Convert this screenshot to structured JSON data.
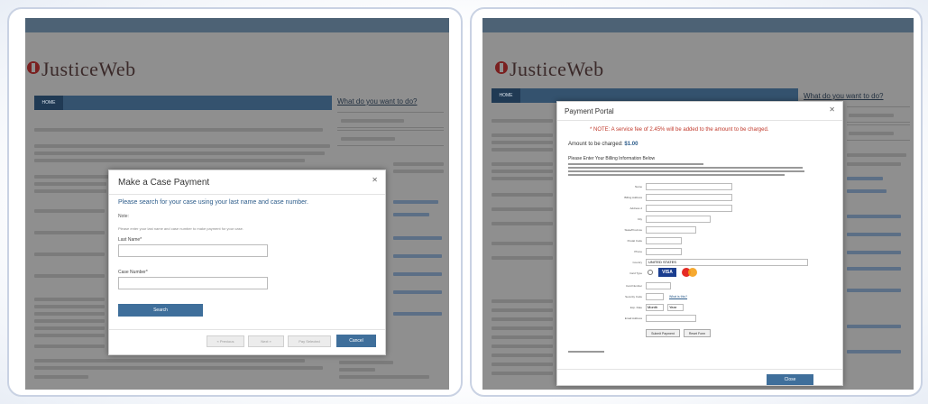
{
  "left": {
    "app_title": "JusticeWeb",
    "tab_home": "HOME",
    "sidebar_heading": "What do you want to do?",
    "modal": {
      "title": "Make a Case Payment",
      "subtitle": "Please search for your case using your last name and case number.",
      "note": "Note:",
      "help": "Please enter your last name and case number to make payment for your case.",
      "last_name_label": "Last Name*",
      "last_name_value": "",
      "case_number_label": "Case Number*",
      "case_number_value": "",
      "search_button": "Search",
      "previous_button": "« Previous",
      "next_button": "Next »",
      "pay_button": "Pay Selected",
      "cancel_button": "Cancel"
    }
  },
  "right": {
    "app_title": "JusticeWeb",
    "tab_home": "HOME",
    "sidebar_heading": "What do you want to do?",
    "modal": {
      "title": "Payment Portal",
      "notice": "* NOTE: A service fee of 2.45% will be added to the amount to be charged.",
      "amount_label": "Amount to be charged:",
      "amount_value": "$1.00",
      "enter_info": "Please Enter Your Billing Information Below",
      "fields": [
        "Name",
        "Billing Address",
        "Address 2",
        "City",
        "State/Province",
        "Postal Code",
        "Phone",
        "Country",
        "Card Type",
        "Card Number",
        "Security Code",
        "Exp. Date",
        "Email Address"
      ],
      "country_value": "UNITED STATES",
      "state_value": "",
      "visa_label": "VISA",
      "card_type_link": "What is this?",
      "exp_month": "Month",
      "exp_year": "Year",
      "submit_button": "Submit Payment",
      "reset_button": "Reset Form",
      "required_note": "Required fields are marked",
      "close_button": "Close"
    }
  }
}
